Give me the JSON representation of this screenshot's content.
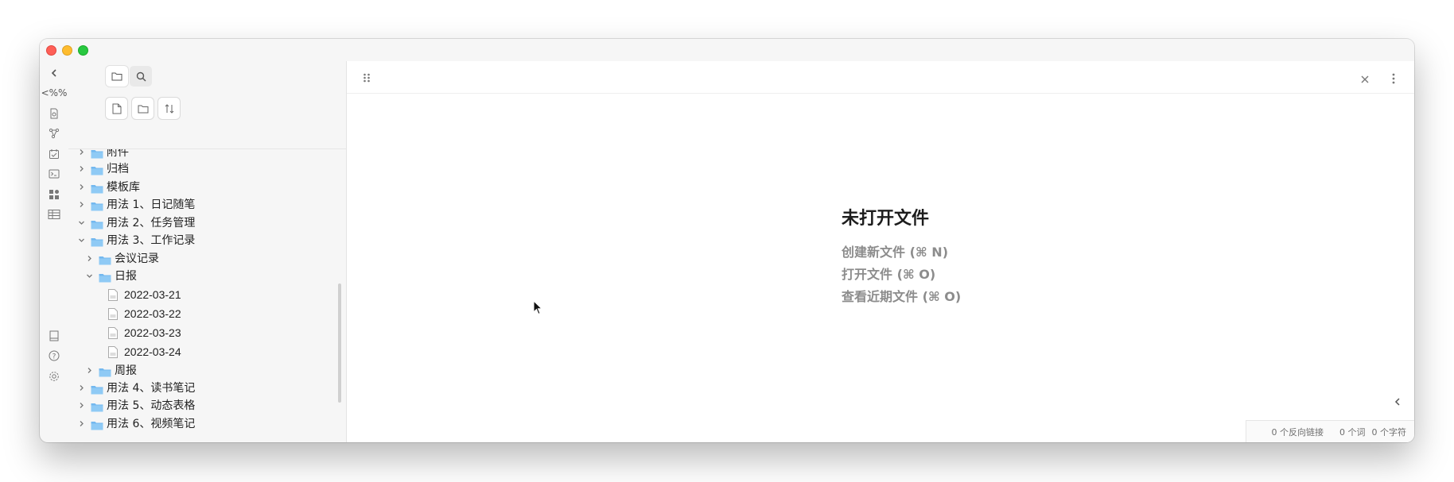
{
  "window": {
    "traffic_lights": [
      "close",
      "minimize",
      "maximize"
    ]
  },
  "ribbon": {
    "icons": [
      "chevron-left-icon",
      "percent-template-icon",
      "file-search-icon",
      "graph-icon",
      "calendar-check-icon",
      "terminal-icon",
      "blocks-icon",
      "table-icon"
    ],
    "bottom_icons": [
      "book-icon",
      "help-icon",
      "settings-icon"
    ],
    "template_label": "<%"
  },
  "sidebar": {
    "tabs": [
      "files-tab",
      "search-tab"
    ],
    "actions": [
      "new-note",
      "new-folder",
      "sort"
    ],
    "tree": [
      {
        "label": "附件",
        "type": "folder",
        "expanded": false,
        "level": 0
      },
      {
        "label": "归档",
        "type": "folder",
        "expanded": false,
        "level": 0
      },
      {
        "label": "模板库",
        "type": "folder",
        "expanded": false,
        "level": 0
      },
      {
        "label": "用法 1、日记随笔",
        "type": "folder",
        "expanded": false,
        "level": 0
      },
      {
        "label": "用法 2、任务管理",
        "type": "folder",
        "expanded": true,
        "level": 0
      },
      {
        "label": "用法 3、工作记录",
        "type": "folder",
        "expanded": true,
        "level": 0
      },
      {
        "label": "会议记录",
        "type": "folder",
        "expanded": false,
        "level": 1
      },
      {
        "label": "日报",
        "type": "folder",
        "expanded": true,
        "level": 1
      },
      {
        "label": "2022-03-21",
        "type": "file",
        "level": 2
      },
      {
        "label": "2022-03-22",
        "type": "file",
        "level": 2
      },
      {
        "label": "2022-03-23",
        "type": "file",
        "level": 2
      },
      {
        "label": "2022-03-24",
        "type": "file",
        "level": 2
      },
      {
        "label": "周报",
        "type": "folder",
        "expanded": false,
        "level": 1
      },
      {
        "label": "用法 4、读书笔记",
        "type": "folder",
        "expanded": false,
        "level": 0
      },
      {
        "label": "用法 5、动态表格",
        "type": "folder",
        "expanded": false,
        "level": 0
      },
      {
        "label": "用法 6、视频笔记",
        "type": "folder",
        "expanded": false,
        "level": 0
      }
    ]
  },
  "main": {
    "empty_title": "未打开文件",
    "links": [
      "创建新文件 (⌘ N)",
      "打开文件 (⌘ O)",
      "查看近期文件 (⌘ O)"
    ]
  },
  "status_bar": {
    "backlinks": "0 个反向链接",
    "words": "0 个词",
    "chars": "0 个字符"
  },
  "colors": {
    "folder": "#73b8ef",
    "accent": "#7b6cd9"
  }
}
